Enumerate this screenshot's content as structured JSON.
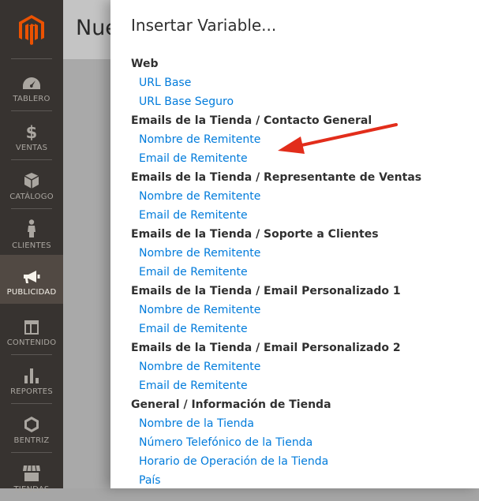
{
  "sidebar": {
    "items": [
      {
        "label": "TABLERO",
        "icon": "dashboard-icon"
      },
      {
        "label": "VENTAS",
        "icon": "dollar-icon"
      },
      {
        "label": "CATÁLOGO",
        "icon": "box-icon"
      },
      {
        "label": "CLIENTES",
        "icon": "person-icon"
      },
      {
        "label": "PUBLICIDAD",
        "icon": "megaphone-icon",
        "active": true
      },
      {
        "label": "CONTENIDO",
        "icon": "layout-icon"
      },
      {
        "label": "REPORTES",
        "icon": "bar-chart-icon"
      },
      {
        "label": "BENTRIZ",
        "icon": "hexagon-icon"
      },
      {
        "label": "TIENDAS",
        "icon": "store-icon"
      }
    ]
  },
  "page": {
    "title": "Nue"
  },
  "modal": {
    "title": "Insertar Variable...",
    "groups": [
      {
        "title": "Web",
        "links": [
          "URL Base",
          "URL Base Seguro"
        ]
      },
      {
        "title": "Emails de la Tienda / Contacto General",
        "links": [
          "Nombre de Remitente",
          "Email de Remitente"
        ]
      },
      {
        "title": "Emails de la Tienda / Representante de Ventas",
        "links": [
          "Nombre de Remitente",
          "Email de Remitente"
        ]
      },
      {
        "title": "Emails de la Tienda / Soporte a Clientes",
        "links": [
          "Nombre de Remitente",
          "Email de Remitente"
        ]
      },
      {
        "title": "Emails de la Tienda / Email Personalizado 1",
        "links": [
          "Nombre de Remitente",
          "Email de Remitente"
        ]
      },
      {
        "title": "Emails de la Tienda / Email Personalizado 2",
        "links": [
          "Nombre de Remitente",
          "Email de Remitente"
        ]
      },
      {
        "title": "General / Información de Tienda",
        "links": [
          "Nombre de la Tienda",
          "Número Telefónico de la Tienda",
          "Horario de Operación de la Tienda",
          "País"
        ]
      }
    ]
  },
  "colors": {
    "sidebar_bg": "#373330",
    "sidebar_active": "#514943",
    "logo_orange": "#eb5202",
    "link": "#007bdb",
    "annotation_arrow": "#e22d1b"
  }
}
